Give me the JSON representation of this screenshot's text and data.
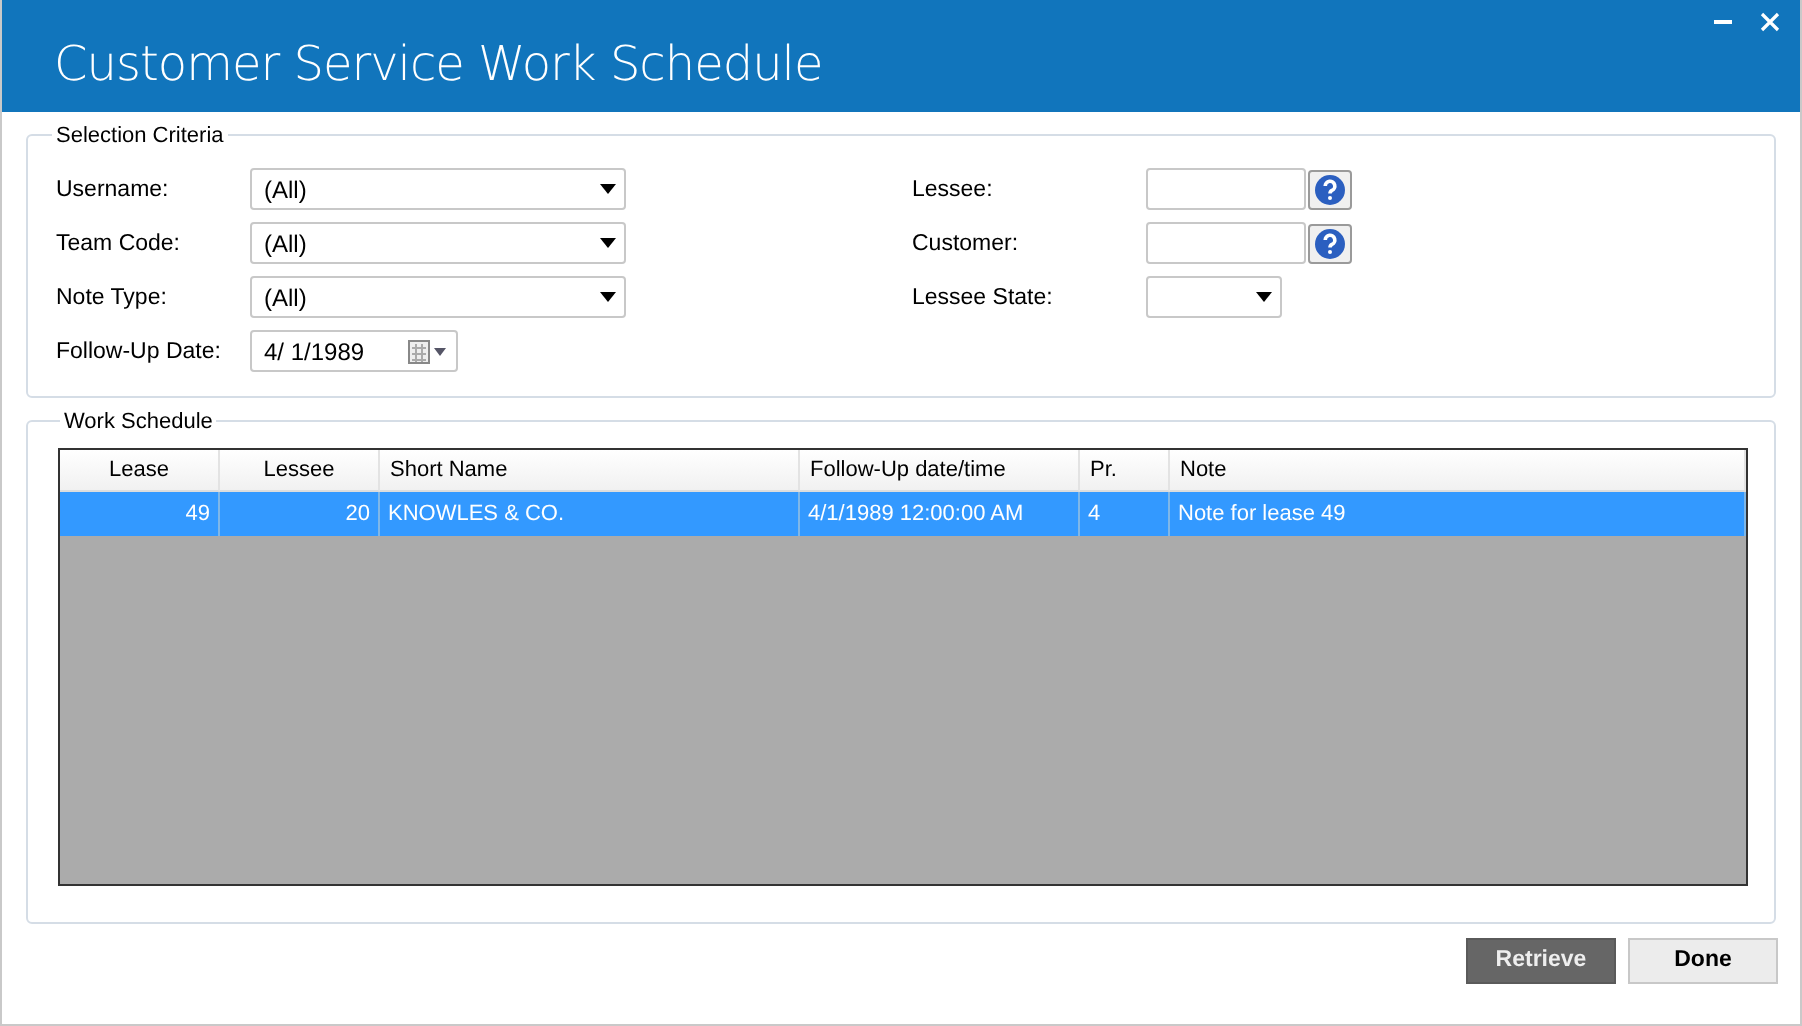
{
  "window": {
    "title": "Customer Service Work Schedule"
  },
  "selection_criteria": {
    "title": "Selection Criteria",
    "left_fields": [
      {
        "label": "Username:",
        "kind": "dropdown",
        "value": "(All)"
      },
      {
        "label": "Team Code:",
        "kind": "dropdown",
        "value": "(All)"
      },
      {
        "label": "Note Type:",
        "kind": "dropdown",
        "value": "(All)"
      },
      {
        "label": "Follow-Up Date:",
        "kind": "date",
        "value": "4/  1/1989"
      }
    ],
    "right_fields": [
      {
        "label": "Lessee:",
        "kind": "lookup"
      },
      {
        "label": "Customer:",
        "kind": "lookup"
      },
      {
        "label": "Lessee State:",
        "kind": "small_dropdown"
      }
    ]
  },
  "work_schedule": {
    "title": "Work Schedule",
    "columns": [
      {
        "label": "Lease",
        "kind": "number"
      },
      {
        "label": "Lessee",
        "kind": "number"
      },
      {
        "label": "Short Name",
        "kind": "text"
      },
      {
        "label": "Follow-Up date/time",
        "kind": "text"
      },
      {
        "label": "Pr.",
        "kind": "text"
      },
      {
        "label": "Note",
        "kind": "text"
      }
    ],
    "rows": [
      {
        "selected": true,
        "cells": [
          "49",
          "20",
          "KNOWLES & CO.",
          "4/1/1989 12:00:00 AM",
          "4",
          "Note for lease 49"
        ]
      }
    ]
  },
  "buttons": [
    {
      "label": "Retrieve",
      "primary": true
    },
    {
      "label": "Done",
      "primary": false
    }
  ]
}
